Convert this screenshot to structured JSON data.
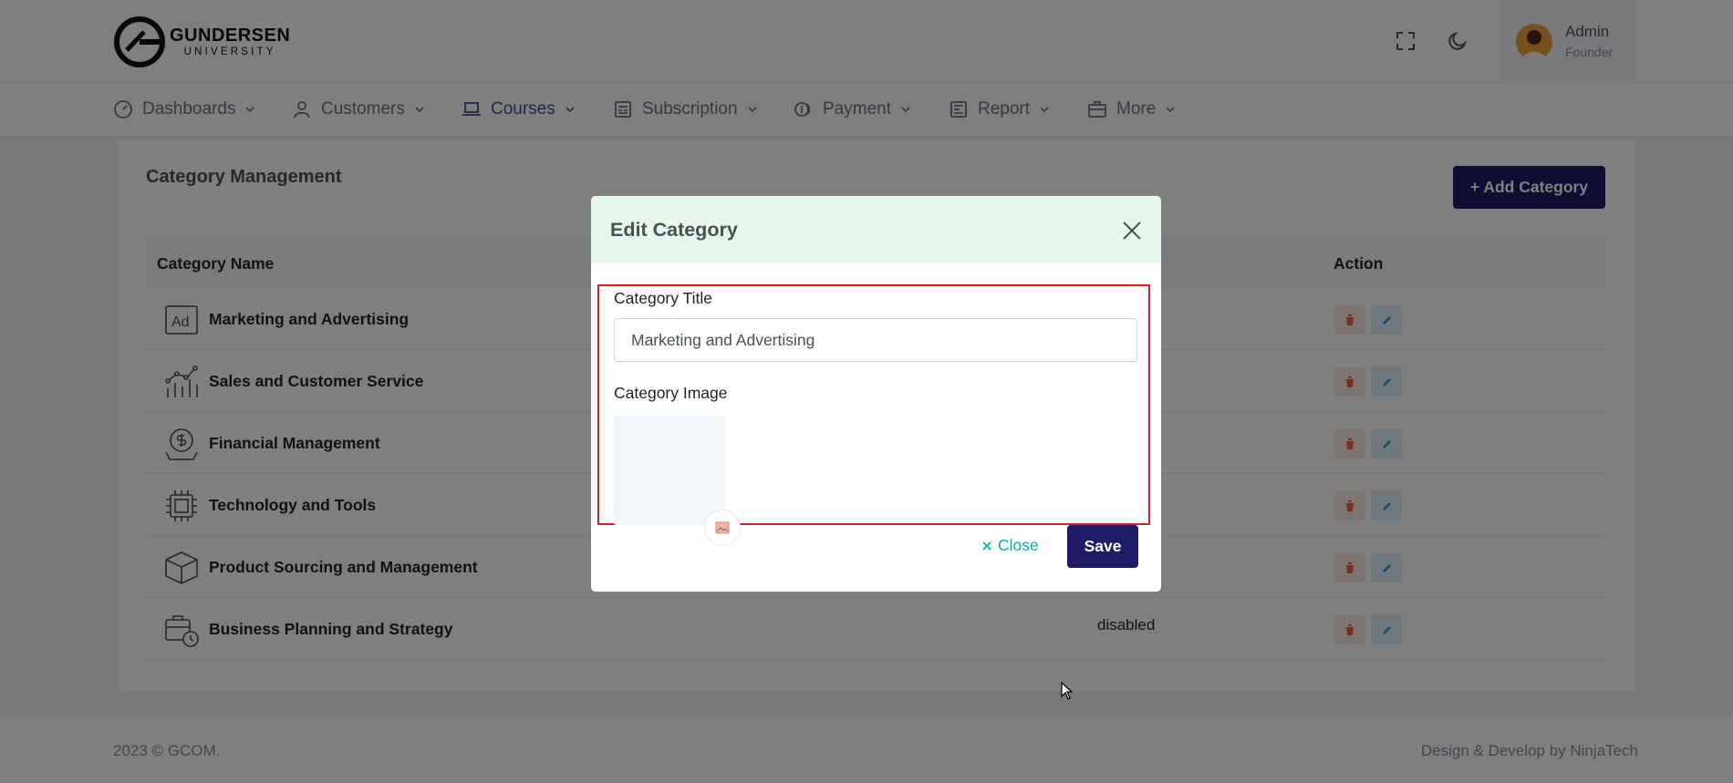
{
  "brand": {
    "name": "GUNDERSEN",
    "sub": "UNIVERSITY"
  },
  "header": {
    "user": {
      "name": "Admin",
      "role": "Founder"
    },
    "icons": [
      "fullscreen-icon",
      "moon-icon"
    ]
  },
  "nav": [
    {
      "label": "Dashboards",
      "icon": "gauge-icon"
    },
    {
      "label": "Customers",
      "icon": "user-icon"
    },
    {
      "label": "Courses",
      "icon": "laptop-icon"
    },
    {
      "label": "Subscription",
      "icon": "subscription-icon"
    },
    {
      "label": "Payment",
      "icon": "coins-icon"
    },
    {
      "label": "Report",
      "icon": "report-icon"
    },
    {
      "label": "More",
      "icon": "briefcase-icon"
    }
  ],
  "page": {
    "title": "Category Management",
    "add_button": "+ Add Category",
    "columns": {
      "name": "Category Name",
      "action": "Action"
    }
  },
  "categories": [
    {
      "name": "Marketing and Advertising",
      "icon": "ad-icon",
      "status": ""
    },
    {
      "name": "Sales and Customer Service",
      "icon": "chart-icon",
      "status": ""
    },
    {
      "name": "Financial Management",
      "icon": "money-icon",
      "status": ""
    },
    {
      "name": "Technology and Tools",
      "icon": "chip-icon",
      "status": ""
    },
    {
      "name": "Product Sourcing and Management",
      "icon": "box-icon",
      "status": ""
    },
    {
      "name": "Business Planning and Strategy",
      "icon": "briefcase-clock-icon",
      "status": "disabled"
    }
  ],
  "modal": {
    "title": "Edit Category",
    "title_label": "Category Title",
    "title_value": "Marketing and Advertising",
    "image_label": "Category Image",
    "close_label": "Close",
    "save_label": "Save"
  },
  "footer": {
    "left": "2023 © GCOM.",
    "right": "Design & Develop by NinjaTech"
  },
  "colors": {
    "primary": "#1f1b65",
    "success": "#0ab39c",
    "danger": "#f06548",
    "info": "#299cdb",
    "highlight": "#e31b23"
  }
}
